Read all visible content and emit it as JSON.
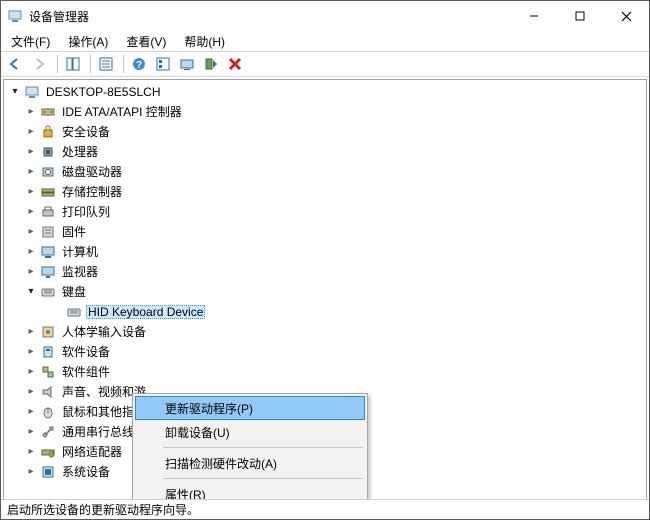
{
  "window": {
    "title": "设备管理器"
  },
  "menu": {
    "file": "文件(F)",
    "action": "操作(A)",
    "view": "查看(V)",
    "help": "帮助(H)"
  },
  "toolbar": {
    "back": "back-icon",
    "forward": "forward-icon",
    "show_hide": "show-hide-tree-icon",
    "properties": "properties-icon",
    "help": "help-icon",
    "console": "console-icon",
    "monitor": "monitor-icon",
    "scan": "scan-hardware-icon",
    "remove": "remove-device-icon"
  },
  "tree": {
    "root": "DESKTOP-8E5SLCH",
    "items": [
      {
        "label": "IDE ATA/ATAPI 控制器",
        "icon": "ide-controller-icon"
      },
      {
        "label": "安全设备",
        "icon": "security-device-icon"
      },
      {
        "label": "处理器",
        "icon": "cpu-icon"
      },
      {
        "label": "磁盘驱动器",
        "icon": "disk-drive-icon"
      },
      {
        "label": "存储控制器",
        "icon": "storage-controller-icon"
      },
      {
        "label": "打印队列",
        "icon": "print-queue-icon"
      },
      {
        "label": "固件",
        "icon": "firmware-icon"
      },
      {
        "label": "计算机",
        "icon": "computer-icon"
      },
      {
        "label": "监视器",
        "icon": "monitor-device-icon"
      },
      {
        "label": "键盘",
        "icon": "keyboard-category-icon",
        "expanded": true
      },
      {
        "label": "人体学输入设备",
        "icon": "hid-icon"
      },
      {
        "label": "软件设备",
        "icon": "software-device-icon"
      },
      {
        "label": "软件组件",
        "icon": "software-component-icon"
      },
      {
        "label": "声音、视频和游戏控制器",
        "icon": "sound-video-game-icon",
        "truncated": "声音、视频和游"
      },
      {
        "label": "鼠标和其他指针设备",
        "icon": "mouse-icon",
        "truncated": "鼠标和其他指针"
      },
      {
        "label": "通用串行总线控制器",
        "icon": "usb-controller-icon"
      },
      {
        "label": "网络适配器",
        "icon": "network-adapter-icon"
      },
      {
        "label": "系统设备",
        "icon": "system-device-icon"
      }
    ],
    "keyboard_child": {
      "label": "HID Keyboard Device",
      "icon": "keyboard-device-icon",
      "selected": true
    }
  },
  "context_menu": {
    "update_driver": "更新驱动程序(P)",
    "uninstall": "卸载设备(U)",
    "scan_hardware": "扫描检测硬件改动(A)",
    "properties": "属性(R)",
    "highlighted": "update_driver"
  },
  "status": "启动所选设备的更新驱动程序向导。"
}
